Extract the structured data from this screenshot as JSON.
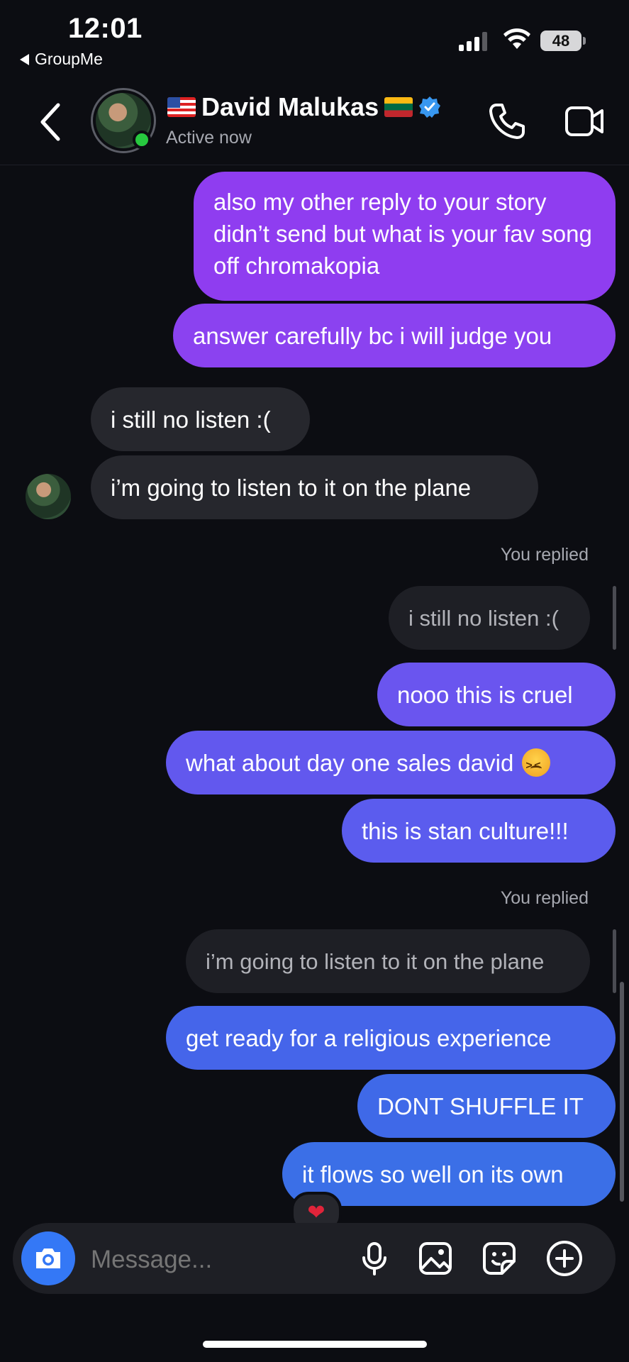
{
  "status_bar": {
    "time": "12:01",
    "back_app": "GroupMe",
    "battery": "48"
  },
  "header": {
    "contact_name": "David Malukas",
    "status": "Active now"
  },
  "messages": [
    {
      "from": "me",
      "text": "also my other reply to your story didn’t send but what is your fav song off chromakopia"
    },
    {
      "from": "me",
      "text": "answer carefully bc i will judge you"
    },
    {
      "from": "them",
      "text": "i still no listen :("
    },
    {
      "from": "them",
      "text": "i’m going to listen to it on the plane"
    },
    {
      "label": "You replied",
      "quoted": "i still no listen :("
    },
    {
      "from": "me",
      "text": "nooo this is cruel"
    },
    {
      "from": "me",
      "text": "what about day one sales david"
    },
    {
      "from": "me",
      "text": "this is stan culture!!!"
    },
    {
      "label": "You replied",
      "quoted": "i’m going to listen to it on the plane"
    },
    {
      "from": "me",
      "text": "get ready for a religious experience"
    },
    {
      "from": "me",
      "text": "DONT SHUFFLE IT"
    },
    {
      "from": "me",
      "text": "it flows so well on its own",
      "reaction": "❤"
    }
  ],
  "composer": {
    "placeholder": "Message..."
  },
  "colors": {
    "background": "#0c0d12",
    "incoming_bubble": "#26272d",
    "gradient_purple": "#9b3cf0",
    "gradient_indigo": "#6a57ef",
    "gradient_blue": "#3b6fe7",
    "online": "#27c93f",
    "accent": "#3478f6"
  },
  "icons": {
    "header": [
      "back-chevron-icon",
      "verified-icon",
      "phone-icon",
      "video-camera-icon"
    ],
    "composer": [
      "camera-icon",
      "microphone-icon",
      "photo-icon",
      "sticker-icon",
      "plus-circle-icon"
    ]
  }
}
